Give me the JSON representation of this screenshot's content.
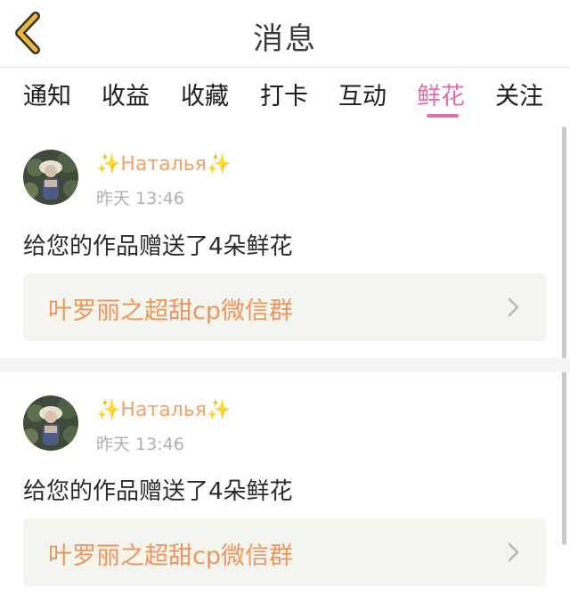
{
  "header": {
    "title": "消息"
  },
  "tabs": [
    {
      "label": "通知",
      "active": false
    },
    {
      "label": "收益",
      "active": false
    },
    {
      "label": "收藏",
      "active": false
    },
    {
      "label": "打卡",
      "active": false
    },
    {
      "label": "互动",
      "active": false
    },
    {
      "label": "鲜花",
      "active": true
    },
    {
      "label": "关注",
      "active": false
    }
  ],
  "colors": {
    "accent": "#e86aa9",
    "username": "#f2a365",
    "group_link": "#f0955a",
    "back_arrow": "#e8b93a"
  },
  "icons": {
    "back": "chevron-left-icon",
    "sparkle": "sparkle-icon",
    "link_arrow": "chevron-right-icon"
  },
  "notifications": [
    {
      "user": {
        "sparkle_left": "✨",
        "name": "Наталья",
        "sparkle_right": "✨"
      },
      "time": "昨天 13:46",
      "message": "给您的作品赠送了4朵鲜花",
      "group_link": "叶罗丽之超甜cp微信群"
    },
    {
      "user": {
        "sparkle_left": "✨",
        "name": "Наталья",
        "sparkle_right": "✨"
      },
      "time": "昨天 13:46",
      "message": "给您的作品赠送了4朵鲜花",
      "group_link": "叶罗丽之超甜cp微信群"
    }
  ]
}
